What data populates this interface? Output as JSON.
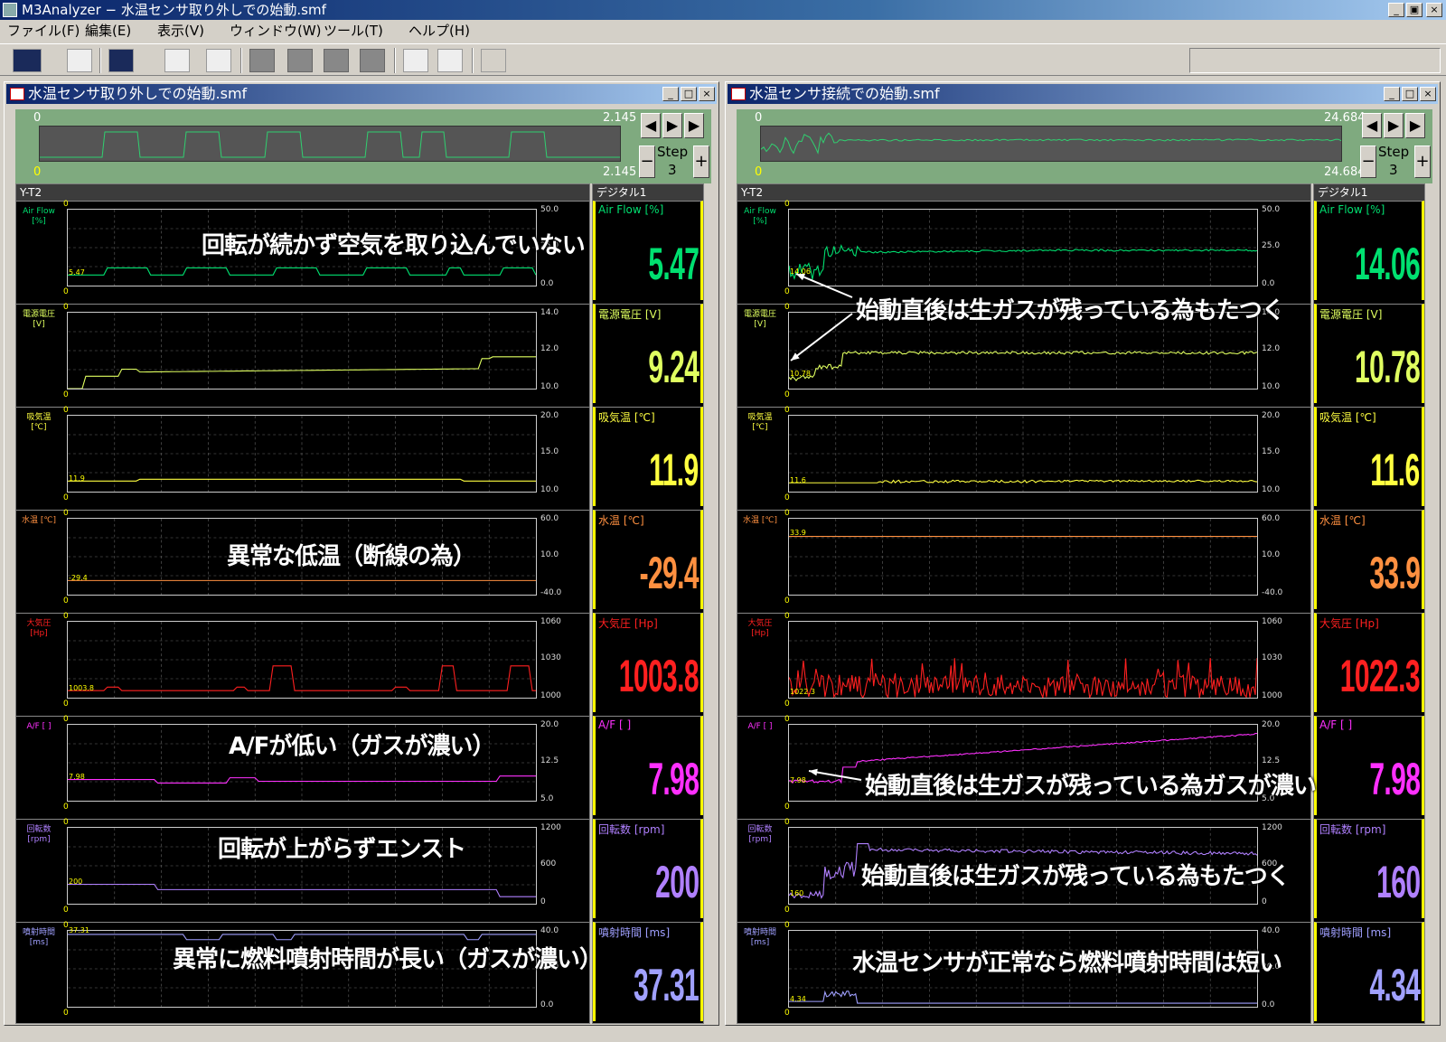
{
  "window": {
    "title": "M3Analyzer − 水温センサ取り外しでの始動.smf"
  },
  "menu": [
    "ファイル(F)",
    "編集(E)",
    "表示(V)",
    "ウィンドウ(W)",
    "ツール(T)",
    "ヘルプ(H)"
  ],
  "toolbar_icons": [
    "chart-icon",
    "scope-icon",
    "transfer-icon",
    "ruler-icon",
    "monitor-icon",
    "gray-block-icon",
    "gray-flag-icon",
    "gray-frame-icon",
    "gray-tzc-icon",
    "preview-icon",
    "print-icon",
    "bug-icon"
  ],
  "panes": [
    {
      "title": "水温センサ取り外しでの始動.smf",
      "ov_start": "0",
      "ov_end": "2.145",
      "ov_start2": "0",
      "ov_end2": "2.145",
      "step_label": "Step",
      "step_val": "3",
      "yt_title": "Y-T2",
      "dg_title": "デジタル1",
      "channels": [
        {
          "name": "Air Flow [%]",
          "color": "#00e070",
          "ytop": "50.0",
          "ymid": "25.0",
          "ybot": "0.0",
          "cursor": "5.47",
          "value": "5.47"
        },
        {
          "name": "電源電圧 [V]",
          "color": "#e0ff60",
          "ytop": "14.0",
          "ymid": "12.0",
          "ybot": "10.0",
          "cursor": "",
          "value": "9.24"
        },
        {
          "name": "吸気温 [℃]",
          "color": "#ffff40",
          "ytop": "20.0",
          "ymid": "15.0",
          "ybot": "10.0",
          "cursor": "11.9",
          "value": "11.9"
        },
        {
          "name": "水温 [℃]",
          "color": "#ff9040",
          "ytop": "60.0",
          "ymid": "10.0",
          "ybot": "-40.0",
          "cursor": "-29.4",
          "value": "-29.4"
        },
        {
          "name": "大気圧 [Hp]",
          "color": "#ff2020",
          "ytop": "1060",
          "ymid": "1030",
          "ybot": "1000",
          "cursor": "1003.8",
          "value": "1003.8"
        },
        {
          "name": "A/F [ ]",
          "color": "#ff30ff",
          "ytop": "20.0",
          "ymid": "12.5",
          "ybot": "5.0",
          "cursor": "7.98",
          "value": "7.98"
        },
        {
          "name": "回転数 [rpm]",
          "color": "#b080ff",
          "ytop": "1200",
          "ymid": "600",
          "ybot": "0",
          "cursor": "200",
          "value": "200"
        },
        {
          "name": "噴射時間 [ms]",
          "color": "#a0a0ff",
          "ytop": "40.0",
          "ymid": "20.0",
          "ybot": "0.0",
          "cursor": "37.31",
          "value": "37.31"
        }
      ],
      "annotations": [
        "回転が続かず空気を取り込んでいない",
        "異常な低温（断線の為）",
        "A/Fが低い（ガスが濃い）",
        "回転が上がらずエンスト",
        "異常に燃料噴射時間が長い（ガスが濃い）"
      ]
    },
    {
      "title": "水温センサ接続での始動.smf",
      "ov_start": "0",
      "ov_end": "24.684",
      "ov_start2": "0",
      "ov_end2": "24.684",
      "step_label": "Step",
      "step_val": "3",
      "yt_title": "Y-T2",
      "dg_title": "デジタル1",
      "channels": [
        {
          "name": "Air Flow [%]",
          "color": "#00e070",
          "ytop": "50.0",
          "ymid": "25.0",
          "ybot": "0.0",
          "cursor": "14.06",
          "value": "14.06"
        },
        {
          "name": "電源電圧 [V]",
          "color": "#e0ff60",
          "ytop": "14.0",
          "ymid": "12.0",
          "ybot": "10.0",
          "cursor": "10.78",
          "value": "10.78"
        },
        {
          "name": "吸気温 [℃]",
          "color": "#ffff40",
          "ytop": "20.0",
          "ymid": "15.0",
          "ybot": "10.0",
          "cursor": "11.6",
          "value": "11.6"
        },
        {
          "name": "水温 [℃]",
          "color": "#ff9040",
          "ytop": "60.0",
          "ymid": "10.0",
          "ybot": "-40.0",
          "cursor": "33.9",
          "value": "33.9"
        },
        {
          "name": "大気圧 [Hp]",
          "color": "#ff2020",
          "ytop": "1060",
          "ymid": "1030",
          "ybot": "1000",
          "cursor": "1022.3",
          "value": "1022.3"
        },
        {
          "name": "A/F [ ]",
          "color": "#ff30ff",
          "ytop": "20.0",
          "ymid": "12.5",
          "ybot": "5.0",
          "cursor": "7.98",
          "value": "7.98"
        },
        {
          "name": "回転数 [rpm]",
          "color": "#b080ff",
          "ytop": "1200",
          "ymid": "600",
          "ybot": "0",
          "cursor": "160",
          "value": "160"
        },
        {
          "name": "噴射時間 [ms]",
          "color": "#a0a0ff",
          "ytop": "40.0",
          "ymid": "20.0",
          "ybot": "0.0",
          "cursor": "4.34",
          "value": "4.34"
        }
      ],
      "annotations": [
        "始動直後は生ガスが残っている為もたつく",
        "始動直後は生ガスが残っている為ガスが濃い",
        "始動直後は生ガスが残っている為もたつく",
        "水温センサが正常なら燃料噴射時間は短い"
      ]
    }
  ]
}
